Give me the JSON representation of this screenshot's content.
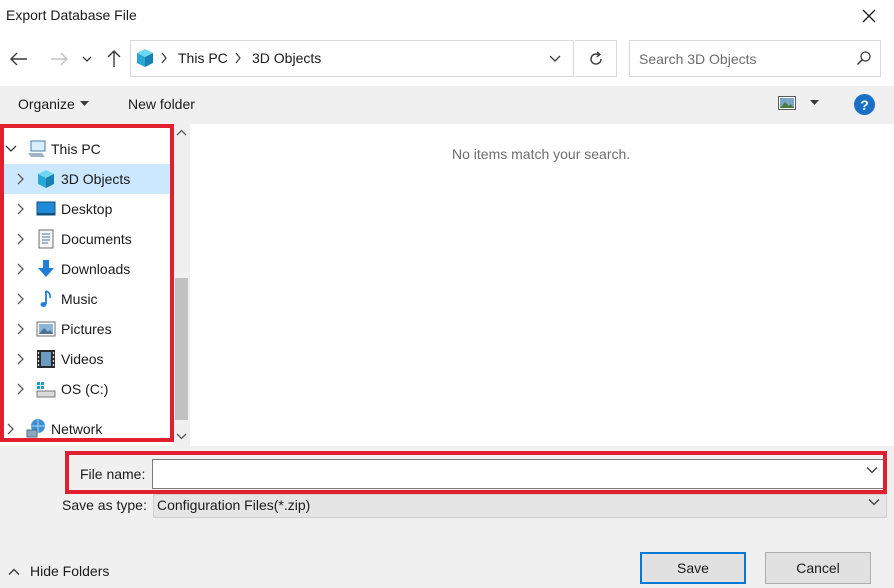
{
  "window": {
    "title": "Export Database File"
  },
  "address": {
    "crumbs": [
      "This PC",
      "3D Objects"
    ]
  },
  "search": {
    "placeholder": "Search 3D Objects"
  },
  "toolbar": {
    "organize": "Organize",
    "new_folder": "New folder",
    "help": "?"
  },
  "nav": {
    "this_pc": "This PC",
    "items": [
      {
        "label": "3D Objects",
        "icon": "cube-icon",
        "selected": true
      },
      {
        "label": "Desktop",
        "icon": "desktop-icon"
      },
      {
        "label": "Documents",
        "icon": "documents-icon"
      },
      {
        "label": "Downloads",
        "icon": "download-icon"
      },
      {
        "label": "Music",
        "icon": "music-note-icon"
      },
      {
        "label": "Pictures",
        "icon": "pictures-icon"
      },
      {
        "label": "Videos",
        "icon": "film-icon"
      },
      {
        "label": "OS (C:)",
        "icon": "drive-icon"
      }
    ],
    "network": "Network"
  },
  "content": {
    "empty_message": "No items match your search."
  },
  "form": {
    "file_name_label": "File name:",
    "file_name_value": "",
    "save_as_type_label": "Save as type:",
    "save_as_type_value": "Configuration Files(*.zip)"
  },
  "footer": {
    "hide_folders": "Hide Folders",
    "save": "Save",
    "cancel": "Cancel"
  },
  "colors": {
    "highlight_outline": "#e0202e",
    "selected_bg": "#cce8ff",
    "accent": "#0078d7"
  }
}
